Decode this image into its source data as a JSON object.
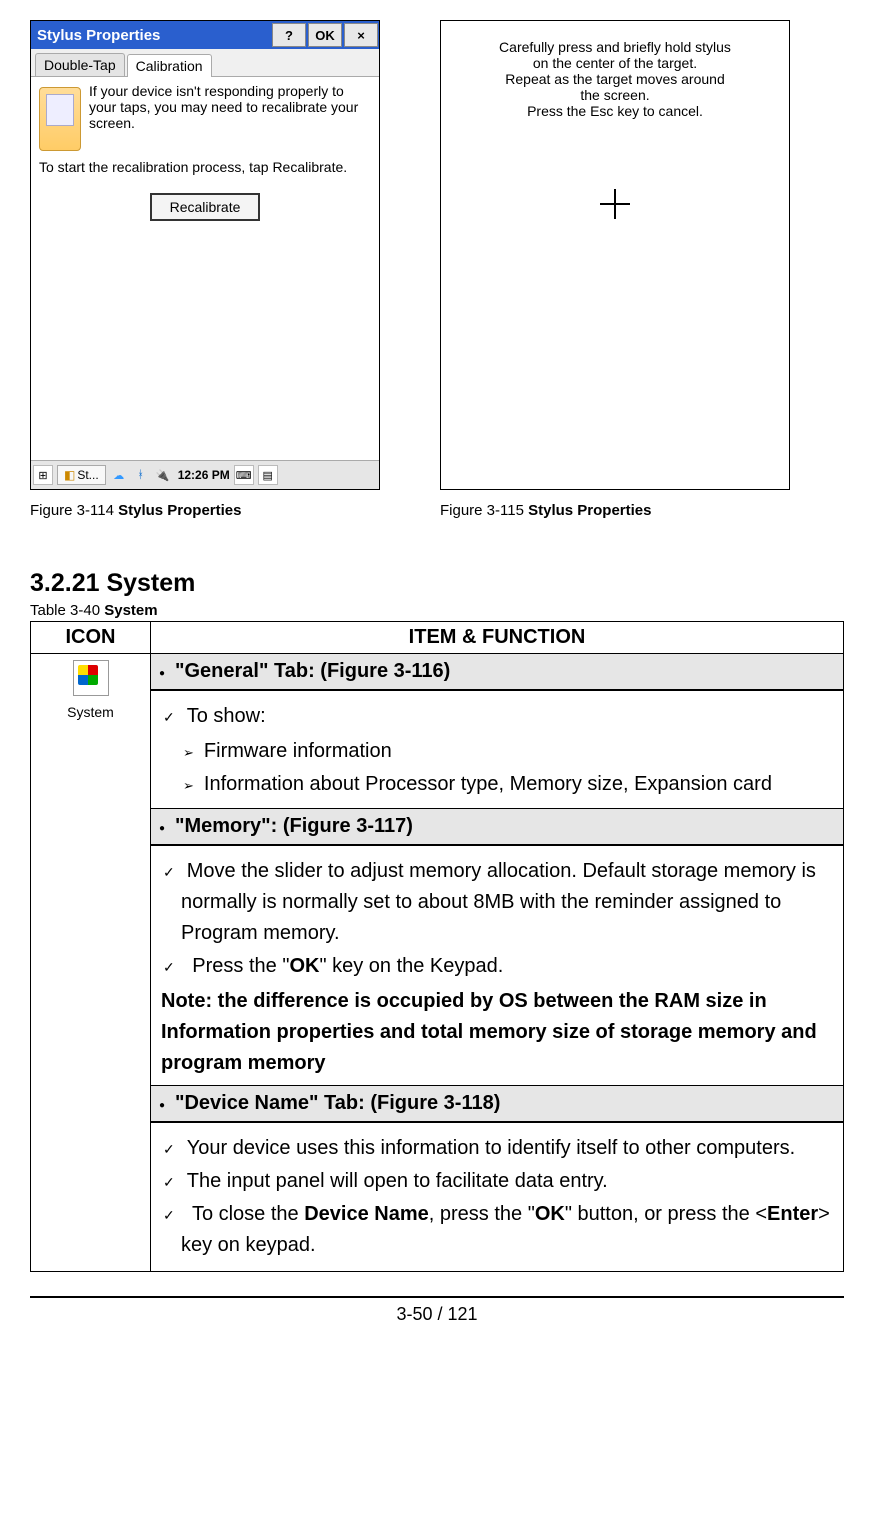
{
  "screen1": {
    "title": "Stylus Properties",
    "help": "?",
    "ok": "OK",
    "close": "×",
    "tab1": "Double-Tap",
    "tab2": "Calibration",
    "body1": "If your device isn't responding properly to your taps, you may need to recalibrate your screen.",
    "body2": "To start the recalibration process, tap Recalibrate.",
    "button": "Recalibrate",
    "task_app": "St...",
    "clock": "12:26 PM"
  },
  "screen2": {
    "line1": "Carefully press and briefly hold stylus",
    "line2": "on the center of the target.",
    "line3": "Repeat as the target moves around",
    "line4": "the screen.",
    "line5": "Press the Esc key to cancel."
  },
  "captions": {
    "fig1_num": "Figure 3-114 ",
    "fig1_title": "Stylus Properties",
    "fig2_num": "Figure 3-115 ",
    "fig2_title": "Stylus Properties"
  },
  "section_heading": "3.2.21 System",
  "table_caption_num": "Table 3-40 ",
  "table_caption_title": "System",
  "table": {
    "h1": "ICON",
    "h2": "ITEM & FUNCTION",
    "icon_label": "System",
    "row1_header": "\"General\" Tab: (Figure 3-116)",
    "row1_c1": "To show:",
    "row1_a1": "Firmware information",
    "row1_a2": "Information about Processor type, Memory size, Expansion card",
    "row2_header": "\"Memory\": (Figure 3-117)",
    "row2_c1": "Move the slider to adjust memory allocation. Default storage memory is normally is normally set to about 8MB with the reminder assigned to Program memory.",
    "row2_c2_pre": "Press the \"",
    "row2_c2_b": "OK",
    "row2_c2_post": "\" key on the Keypad.",
    "row2_note": "Note: the difference is occupied by OS between the RAM size in Information properties and total memory size of storage memory and program memory",
    "row3_header": "\"Device Name\" Tab: (Figure 3-118)",
    "row3_c1": "Your device uses this information to identify itself to other computers.",
    "row3_c2": "The input panel will open to facilitate data entry.",
    "row3_c3_pre": "To close the ",
    "row3_c3_b1": "Device Name",
    "row3_c3_mid": ", press the \"",
    "row3_c3_b2": "OK",
    "row3_c3_mid2": "\" button, or press the <",
    "row3_c3_b3": "Enter",
    "row3_c3_post": "> key on keypad."
  },
  "footer": "3-50 / 121"
}
